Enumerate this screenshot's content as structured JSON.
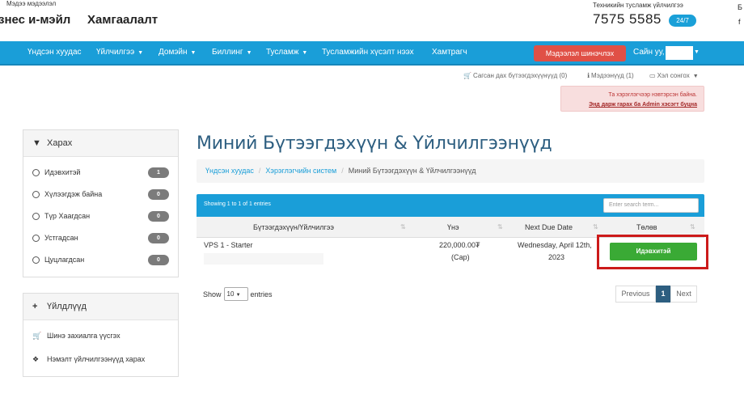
{
  "header": {
    "top_small": "Мэдээ мэдээлэл",
    "brand_left": "знес и-мэйл",
    "brand_right": "Хамгаалалт",
    "support_label": "Техникийн тусламж үйлчилгээ",
    "phone": "7575 5585",
    "badge": "24/7",
    "edge_top": "Б",
    "edge_bottom": "f"
  },
  "nav": {
    "items": [
      {
        "label": "Үндсэн хуудас",
        "has_caret": false
      },
      {
        "label": "Үйлчилгээ",
        "has_caret": true
      },
      {
        "label": "Домэйн",
        "has_caret": true
      },
      {
        "label": "Биллинг",
        "has_caret": true
      },
      {
        "label": "Тусламж",
        "has_caret": true
      },
      {
        "label": "Тусламжийн хүсэлт нээх",
        "has_caret": false
      },
      {
        "label": "Хамтрагч",
        "has_caret": false
      }
    ],
    "update_button": "Мэдээлэл шинэчлэх",
    "greeting": "Сайн уу,"
  },
  "utility": {
    "cart": "Сагсан дах бүтээгдэхүүнүүд (0)",
    "notices": "Мэдээнүүд (1)",
    "language": "Хэл сонгох"
  },
  "alert": {
    "line1": "Та хэрэглэгчээр нэвтэрсэн байна.",
    "line2": "Энд дарж гарах ба Admin хэсэгт буцна"
  },
  "sidebar": {
    "view_panel": {
      "title": "Харах",
      "filters": [
        {
          "label": "Идэвхитэй",
          "count": "1"
        },
        {
          "label": "Хүлээгдэж байна",
          "count": "0"
        },
        {
          "label": "Түр Хаагдсан",
          "count": "0"
        },
        {
          "label": "Устгадсан",
          "count": "0"
        },
        {
          "label": "Цуцлагдсан",
          "count": "0"
        }
      ]
    },
    "actions_panel": {
      "title": "Үйлдлүүд",
      "items": [
        {
          "label": "Шинэ захиалга үүсгэх",
          "icon": "cart-icon"
        },
        {
          "label": "Нэмэлт үйлчилгээнүүд харах",
          "icon": "cubes-icon"
        }
      ]
    }
  },
  "main": {
    "title": "Миний Бүтээгдэхүүн & Үйлчилгээнүүд",
    "breadcrumb": [
      "Үндсэн хуудас",
      "Хэрэглэгчийн систем",
      "Миний Бүтээгдэхүүн & Үйлчилгээнүүд"
    ],
    "table": {
      "showing": "Showing 1 to 1 of 1 entries",
      "search_placeholder": "Enter search term...",
      "columns": [
        "Бүтээгдэхүүн/Үйлчилгээ",
        "Үнэ",
        "Next Due Date",
        "Төлөв"
      ],
      "rows": [
        {
          "product": "VPS 1 - Starter",
          "price": "220,000.00₮",
          "cycle": "(Сар)",
          "due_line1": "Wednesday, April 12th,",
          "due_line2": "2023",
          "status": "Идэвхитэй"
        }
      ],
      "show_label": "Show",
      "show_value": "10",
      "entries_label": "entries",
      "pagination": {
        "previous": "Previous",
        "current": "1",
        "next": "Next"
      }
    }
  },
  "colors": {
    "accent": "#1a9ed8",
    "title": "#2d5e80",
    "status_active": "#3aaa35",
    "danger": "#e05046",
    "highlight": "#cc1a1a"
  }
}
